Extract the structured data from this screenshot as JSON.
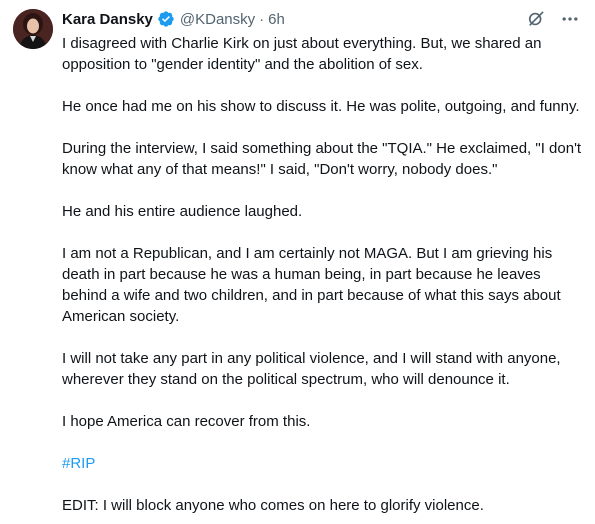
{
  "author": {
    "display_name": "Kara Dansky",
    "handle": "@KDansky",
    "separator": "·",
    "time": "6h",
    "verified": true,
    "verified_color": "#1d9bf0"
  },
  "actions": {
    "grok_icon": "grok-icon",
    "more_icon": "more-icon"
  },
  "body": {
    "p1": "I disagreed with Charlie Kirk on just about everything. But, we shared an opposition to \"gender identity\" and the abolition of sex.",
    "p2": "He once had me on his show to discuss it. He was polite, outgoing, and funny.",
    "p3": "During the interview, I said something about the \"TQIA.\" He exclaimed, \"I don't know what any of that means!\" I said, \"Don't worry, nobody does.\"",
    "p4": "He and his entire audience laughed.",
    "p5": "I am not a Republican, and I am certainly not MAGA. But I am grieving his death in part because he was a human being, in part because he leaves behind a wife and two children, and in part because of what this says about American society.",
    "p6": "I will not take any part in any political violence, and I will stand with anyone, wherever they stand on the political spectrum, who will denounce it.",
    "p7": "I hope America can recover from this.",
    "hashtag": "#RIP",
    "p8": "EDIT: I will block anyone who comes on here to glorify violence."
  },
  "colors": {
    "text": "#0f1419",
    "muted": "#536471",
    "link": "#1d9bf0"
  }
}
